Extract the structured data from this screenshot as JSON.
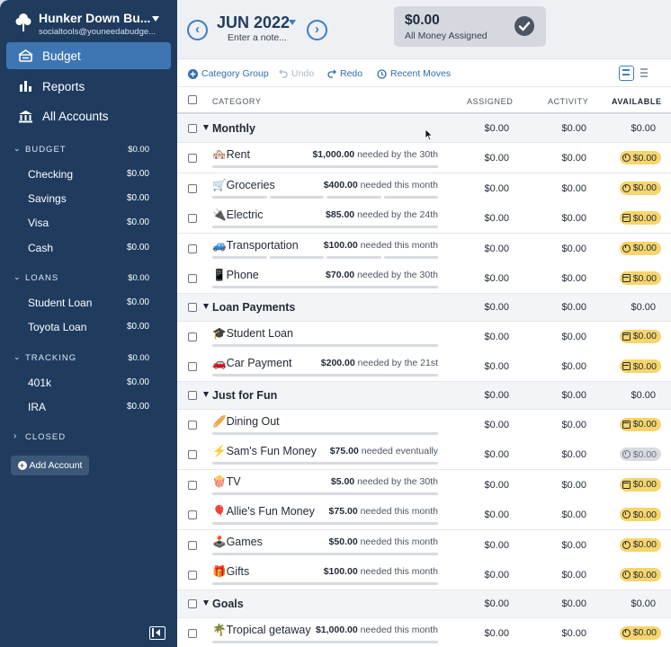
{
  "sidebar": {
    "budget_name": "Hunker Down Bu...",
    "email": "socialtools@youneedabudge...",
    "nav": [
      {
        "label": "Budget",
        "icon": "budget-icon"
      },
      {
        "label": "Reports",
        "icon": "bar-chart-icon"
      },
      {
        "label": "All Accounts",
        "icon": "bank-icon"
      }
    ],
    "groups": [
      {
        "name": "BUDGET",
        "amount": "$0.00",
        "accounts": [
          {
            "name": "Checking",
            "amount": "$0.00"
          },
          {
            "name": "Savings",
            "amount": "$0.00"
          },
          {
            "name": "Visa",
            "amount": "$0.00"
          },
          {
            "name": "Cash",
            "amount": "$0.00"
          }
        ]
      },
      {
        "name": "LOANS",
        "amount": "$0.00",
        "accounts": [
          {
            "name": "Student Loan",
            "amount": "$0.00"
          },
          {
            "name": "Toyota Loan",
            "amount": "$0.00"
          }
        ]
      },
      {
        "name": "TRACKING",
        "amount": "$0.00",
        "accounts": [
          {
            "name": "401k",
            "amount": "$0.00"
          },
          {
            "name": "IRA",
            "amount": "$0.00"
          }
        ]
      },
      {
        "name": "CLOSED",
        "amount": "",
        "accounts": []
      }
    ],
    "add_account": "Add Account"
  },
  "header": {
    "month": "JUN 2022",
    "note_placeholder": "Enter a note...",
    "to_assign_amount": "$0.00",
    "to_assign_label": "All Money Assigned"
  },
  "toolbar": {
    "category_group": "Category Group",
    "undo": "Undo",
    "redo": "Redo",
    "recent_moves": "Recent Moves"
  },
  "columns": {
    "category": "CATEGORY",
    "assigned": "ASSIGNED",
    "activity": "ACTIVITY",
    "available": "AVAILABLE"
  },
  "budget_rows": [
    {
      "type": "group",
      "name": "Monthly",
      "assigned": "$0.00",
      "activity": "$0.00",
      "available": "$0.00"
    },
    {
      "type": "cat",
      "emoji": "🏘️",
      "name": "Rent",
      "target_amount": "$1,000.00",
      "target_text": "needed by the 30th",
      "assigned": "$0.00",
      "activity": "$0.00",
      "available": "$0.00",
      "pill": "yellow",
      "icon": "clock"
    },
    {
      "type": "cat",
      "emoji": "🛒",
      "name": "Groceries",
      "target_amount": "$400.00",
      "target_text": "needed this month",
      "assigned": "$0.00",
      "activity": "$0.00",
      "available": "$0.00",
      "pill": "yellow",
      "icon": "clock",
      "segments": 4
    },
    {
      "type": "cat",
      "emoji": "🔌",
      "name": "Electric",
      "target_amount": "$85.00",
      "target_text": "needed by the 24th",
      "assigned": "$0.00",
      "activity": "$0.00",
      "available": "$0.00",
      "pill": "yellow",
      "icon": "cal"
    },
    {
      "type": "cat",
      "emoji": "🚙",
      "name": "Transportation",
      "target_amount": "$100.00",
      "target_text": "needed this month",
      "assigned": "$0.00",
      "activity": "$0.00",
      "available": "$0.00",
      "pill": "yellow",
      "icon": "clock",
      "segments": 4
    },
    {
      "type": "cat",
      "emoji": "📱",
      "name": "Phone",
      "target_amount": "$70.00",
      "target_text": "needed by the 30th",
      "assigned": "$0.00",
      "activity": "$0.00",
      "available": "$0.00",
      "pill": "yellow",
      "icon": "cal"
    },
    {
      "type": "group",
      "name": "Loan Payments",
      "assigned": "$0.00",
      "activity": "$0.00",
      "available": "$0.00"
    },
    {
      "type": "cat",
      "emoji": "🎓",
      "name": "Student Loan",
      "target_amount": "",
      "target_text": "",
      "assigned": "$0.00",
      "activity": "$0.00",
      "available": "$0.00",
      "pill": "yellow",
      "icon": "cal"
    },
    {
      "type": "cat",
      "emoji": "🚗",
      "name": "Car Payment",
      "target_amount": "$200.00",
      "target_text": "needed by the 21st",
      "assigned": "$0.00",
      "activity": "$0.00",
      "available": "$0.00",
      "pill": "yellow",
      "icon": "cal"
    },
    {
      "type": "group",
      "name": "Just for Fun",
      "assigned": "$0.00",
      "activity": "$0.00",
      "available": "$0.00"
    },
    {
      "type": "cat",
      "emoji": "🥖",
      "name": "Dining Out",
      "target_amount": "",
      "target_text": "",
      "assigned": "$0.00",
      "activity": "$0.00",
      "available": "$0.00",
      "pill": "yellow",
      "icon": "cal"
    },
    {
      "type": "cat",
      "emoji": "⚡",
      "name": "Sam's Fun Money",
      "target_amount": "$75.00",
      "target_text": "needed eventually",
      "assigned": "$0.00",
      "activity": "$0.00",
      "available": "$0.00",
      "pill": "gray",
      "icon": "clock"
    },
    {
      "type": "cat",
      "emoji": "🍿",
      "name": "TV",
      "target_amount": "$5.00",
      "target_text": "needed by the 30th",
      "assigned": "$0.00",
      "activity": "$0.00",
      "available": "$0.00",
      "pill": "yellow",
      "icon": "cal"
    },
    {
      "type": "cat",
      "emoji": "🎈",
      "name": "Allie's Fun Money",
      "target_amount": "$75.00",
      "target_text": "needed this month",
      "assigned": "$0.00",
      "activity": "$0.00",
      "available": "$0.00",
      "pill": "yellow",
      "icon": "clock"
    },
    {
      "type": "cat",
      "emoji": "🕹️",
      "name": "Games",
      "target_amount": "$50.00",
      "target_text": "needed this month",
      "assigned": "$0.00",
      "activity": "$0.00",
      "available": "$0.00",
      "pill": "yellow",
      "icon": "clock"
    },
    {
      "type": "cat",
      "emoji": "🎁",
      "name": "Gifts",
      "target_amount": "$100.00",
      "target_text": "needed this month",
      "assigned": "$0.00",
      "activity": "$0.00",
      "available": "$0.00",
      "pill": "yellow",
      "icon": "clock"
    },
    {
      "type": "group",
      "name": "Goals",
      "assigned": "$0.00",
      "activity": "$0.00",
      "available": "$0.00"
    },
    {
      "type": "cat",
      "emoji": "🌴",
      "name": "Tropical getaway",
      "target_amount": "$1,000.00",
      "target_text": "needed this month",
      "assigned": "$0.00",
      "activity": "$0.00",
      "available": "$0.00",
      "pill": "yellow",
      "icon": "clock"
    }
  ],
  "colors": {
    "sidebar_bg": "#1f3c5f",
    "active_nav": "#3e76b3",
    "accent": "#3e7dc4",
    "pill_yellow": "#f7d56b",
    "pill_gray": "#d8dbe0"
  }
}
